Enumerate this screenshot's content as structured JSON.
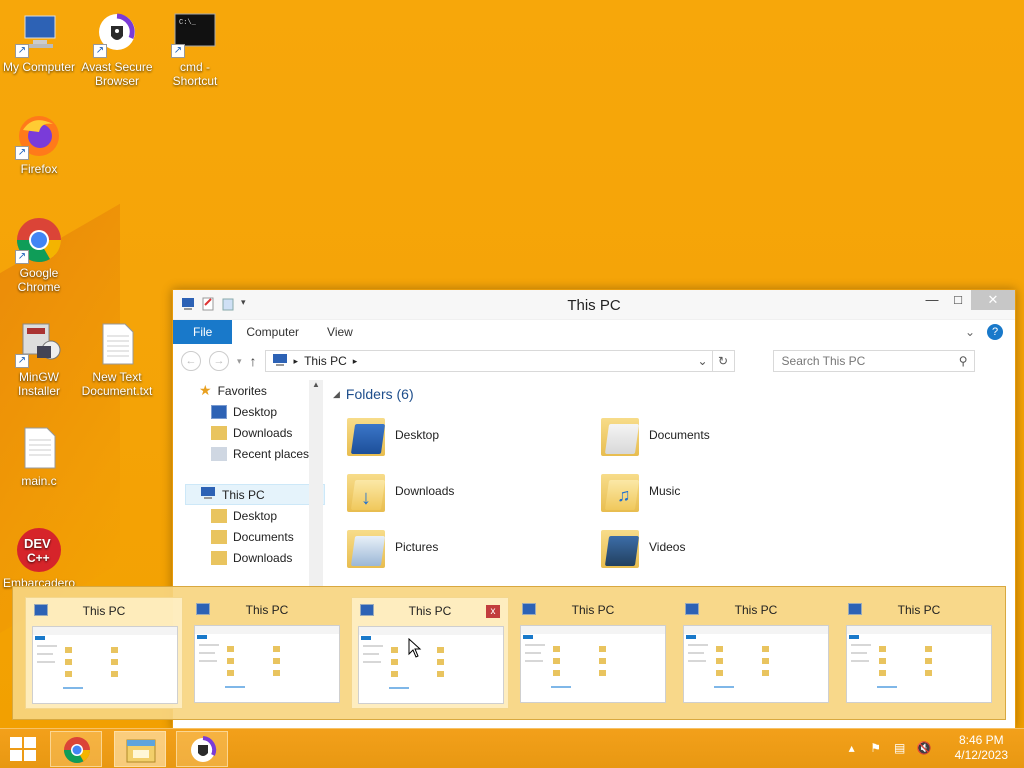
{
  "desktop": {
    "icons": [
      {
        "label": "My Computer"
      },
      {
        "label": "Avast Secure Browser"
      },
      {
        "label": "cmd - Shortcut"
      },
      {
        "label": "Firefox"
      },
      {
        "label": "Google Chrome"
      },
      {
        "label": "MinGW Installer"
      },
      {
        "label": "New Text Document.txt"
      },
      {
        "label": "main.c"
      },
      {
        "label": "Embarcadero"
      }
    ]
  },
  "explorer": {
    "title": "This PC",
    "ribbon_tabs": {
      "file": "File",
      "computer": "Computer",
      "view": "View"
    },
    "address": {
      "location": "This PC"
    },
    "search_placeholder": "Search This PC",
    "nav": {
      "favorites": "Favorites",
      "fav_items": [
        "Desktop",
        "Downloads",
        "Recent places"
      ],
      "this_pc": "This PC",
      "pc_items": [
        "Desktop",
        "Documents",
        "Downloads"
      ]
    },
    "folders_header": "Folders (6)",
    "folders": [
      "Desktop",
      "Documents",
      "Downloads",
      "Music",
      "Pictures",
      "Videos"
    ]
  },
  "thumbnails": {
    "titles": [
      "This PC",
      "This PC",
      "This PC",
      "This PC",
      "This PC",
      "This PC"
    ],
    "close_glyph": "x"
  },
  "taskbar": {
    "time": "8:46 PM",
    "date": "4/12/2023"
  },
  "colors": {
    "desktop": "#f5a408",
    "accent": "#1979ca"
  }
}
